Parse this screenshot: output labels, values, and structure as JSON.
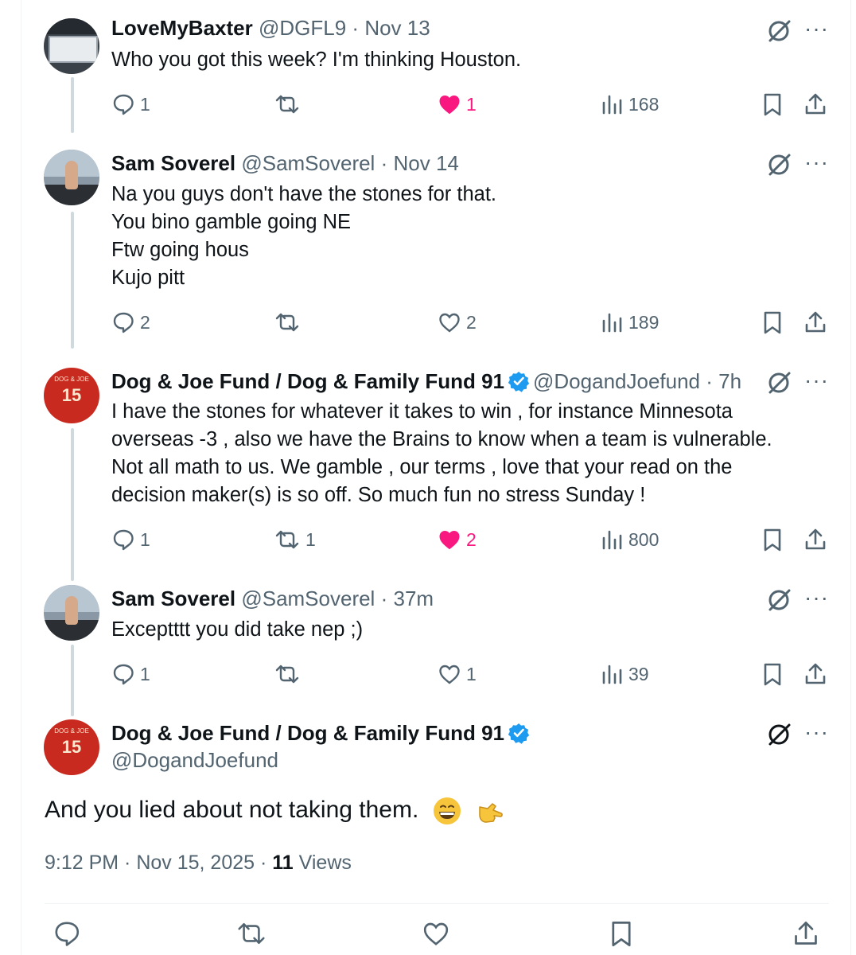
{
  "colors": {
    "like_pink": "#f91880",
    "verified_blue": "#1d9bf0",
    "muted": "#536471",
    "text": "#0f1419"
  },
  "replies": [
    {
      "name": "LoveMyBaxter",
      "handle": "@DGFL9",
      "sep": "·",
      "time": "Nov 13",
      "lines": [
        "Who you got this week? I'm thinking Houston."
      ],
      "reply_count": "1",
      "repost_count": "",
      "like_count": "1",
      "views": "168",
      "liked": true
    },
    {
      "name": "Sam Soverel",
      "handle": "@SamSoverel",
      "sep": "·",
      "time": "Nov 14",
      "lines": [
        "Na you guys don't have the stones for that.",
        "You bino gamble going NE",
        "Ftw going hous",
        "Kujo pitt"
      ],
      "reply_count": "2",
      "repost_count": "",
      "like_count": "2",
      "views": "189",
      "liked": false
    },
    {
      "name": "Dog & Joe Fund / Dog & Family Fund 91",
      "handle": "@DogandJoefund",
      "sep": "·",
      "time": "7h",
      "verified": true,
      "lines": [
        "I have the stones for whatever it takes to win , for instance Minnesota",
        "overseas -3 , also we have the Brains to know when a team is vulnerable.",
        "Not all math to us. We gamble , our terms , love that your read on the",
        "decision maker(s) is so off.  So much fun no stress Sunday !"
      ],
      "reply_count": "1",
      "repost_count": "1",
      "like_count": "2",
      "views": "800",
      "liked": true
    },
    {
      "name": "Sam Soverel",
      "handle": "@SamSoverel",
      "sep": "·",
      "time": "37m",
      "lines": [
        "Exceptttt you did take nep ;)"
      ],
      "reply_count": "1",
      "repost_count": "",
      "like_count": "1",
      "views": "39",
      "liked": false
    }
  ],
  "main_post": {
    "name": "Dog & Joe Fund / Dog & Family Fund 91",
    "handle": "@DogandJoefund",
    "text": "And you lied about not taking them.",
    "emojis": [
      "grinning-face",
      "pointing-hand"
    ],
    "timestamp": "9:12 PM · Nov 15, 2025 · ",
    "views_count": "11",
    "views_label": " Views"
  },
  "avatar_labels": {
    "dog_number": "15",
    "dog_caption": "DOG & JOE"
  },
  "icons": [
    "reply-icon",
    "repost-icon",
    "like-icon",
    "views-icon",
    "bookmark-icon",
    "share-icon",
    "grok-icon",
    "more-icon",
    "verified-badge-icon"
  ]
}
